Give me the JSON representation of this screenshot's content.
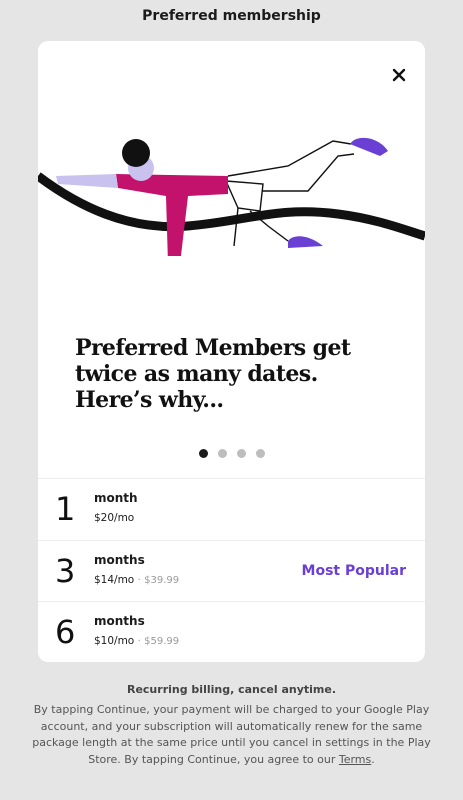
{
  "header": {
    "title": "Preferred membership"
  },
  "card": {
    "close_icon": "close-icon",
    "headline": "Preferred Members get twice as many dates. Here’s why...",
    "carousel": {
      "count": 4,
      "active_index": 0
    }
  },
  "plans": [
    {
      "number": "1",
      "unit": "month",
      "price": "$20/mo",
      "original": "",
      "badge": ""
    },
    {
      "number": "3",
      "unit": "months",
      "price": "$14/mo",
      "original": "$39.99",
      "badge": "Most Popular"
    },
    {
      "number": "6",
      "unit": "months",
      "price": "$10/mo",
      "original": "$59.99",
      "badge": ""
    }
  ],
  "separator": "·",
  "billing": {
    "title": "Recurring billing, cancel anytime.",
    "body": "By tapping Continue, your payment will be charged to your Google Play account, and your subscription will automatically renew for the same package length at the same price until you cancel in settings in the Play Store. By tapping Continue, you agree to our ",
    "terms_link": "Terms",
    "terms_suffix": "."
  },
  "colors": {
    "accent": "#6a3fd4",
    "illustration_shirt": "#c2126b",
    "illustration_skin": "#c9c2ef",
    "illustration_sock": "#6a3fd4"
  }
}
